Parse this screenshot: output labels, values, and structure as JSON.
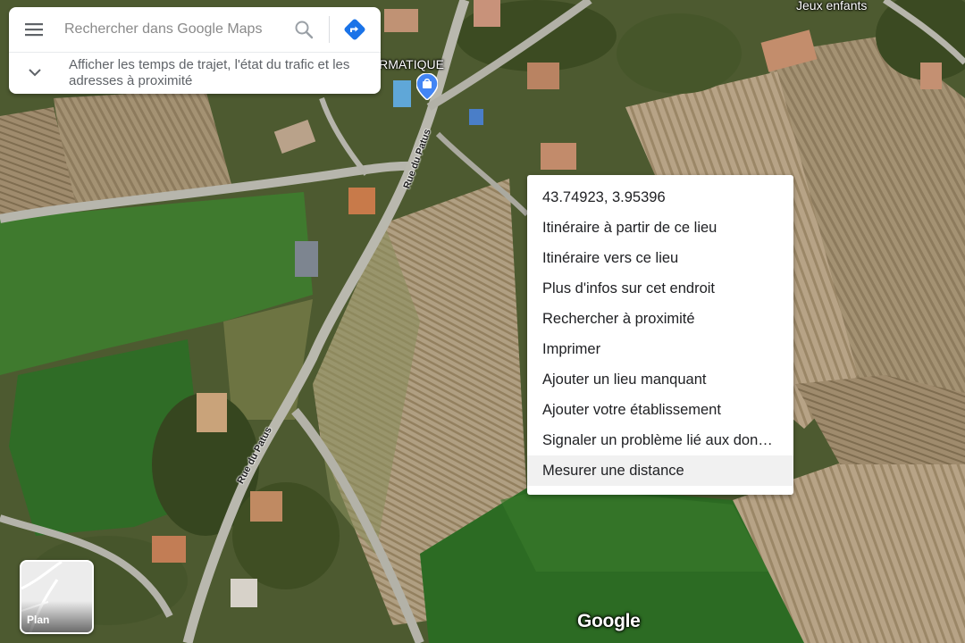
{
  "search": {
    "placeholder": "Rechercher dans Google Maps",
    "hint": "Afficher les temps de trajet, l'état du trafic et les adresses à proximité",
    "menu_icon": "hamburger-menu-icon",
    "search_icon": "magnifier-icon",
    "directions_icon": "directions-icon",
    "expand_icon": "chevron-down-icon"
  },
  "context_menu": {
    "items": [
      "43.74923, 3.95396",
      "Itinéraire à partir de ce lieu",
      "Itinéraire vers ce lieu",
      "Plus d'infos sur cet endroit",
      "Rechercher à proximité",
      "Imprimer",
      "Ajouter un lieu manquant",
      "Ajouter votre établissement",
      "Signaler un problème lié aux données cartographiques",
      "Mesurer une distance"
    ],
    "hovered_item": "Mesurer une distance"
  },
  "map": {
    "poi_label": "DRMATIQUE",
    "place_label": "Jeux enfants",
    "street_labels": [
      "Rue du Patus",
      "Rue du Patus"
    ]
  },
  "layer_switcher": {
    "label": "Plan"
  },
  "attribution": {
    "logo": "Google"
  },
  "colors": {
    "directions_blue": "#1a73e8",
    "pin_blue": "#4285f4",
    "menu_hover": "#f1f1f1"
  }
}
